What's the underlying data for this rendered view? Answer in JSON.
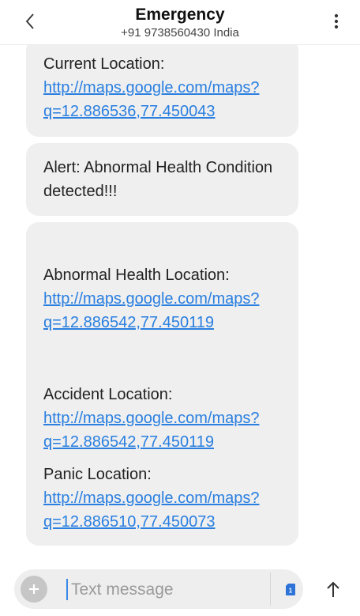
{
  "header": {
    "title": "Emergency",
    "subtitle": "+91 9738560430 India"
  },
  "messages": [
    {
      "prefix": "Current Location: ",
      "link": "http://maps.google.com/maps?q=12.886536,77.450043"
    },
    {
      "prefix": "Alert: Abnormal Health Condition detected!!!",
      "link": ""
    },
    {
      "prefix": "Abnormal Health Location: ",
      "link": "http://maps.google.com/maps?q=12.886542,77.450119"
    },
    {
      "prefix": "Accident Location: ",
      "link": "http://maps.google.com/maps?q=12.886542,77.450119"
    },
    {
      "prefix": "Panic Location: ",
      "link": "http://maps.google.com/maps?q=12.886510,77.450073"
    }
  ],
  "composer": {
    "placeholder": "Text message",
    "sim_label": "1"
  },
  "icons": {
    "back": "chevron-left-icon",
    "menu": "more-vert-icon",
    "add": "plus-icon",
    "sim": "sim-card-icon",
    "send": "arrow-up-icon"
  },
  "colors": {
    "link": "#2a7fe0",
    "bubble": "#efefef",
    "cursor": "#3a88e8",
    "sim": "#2d73d8"
  }
}
